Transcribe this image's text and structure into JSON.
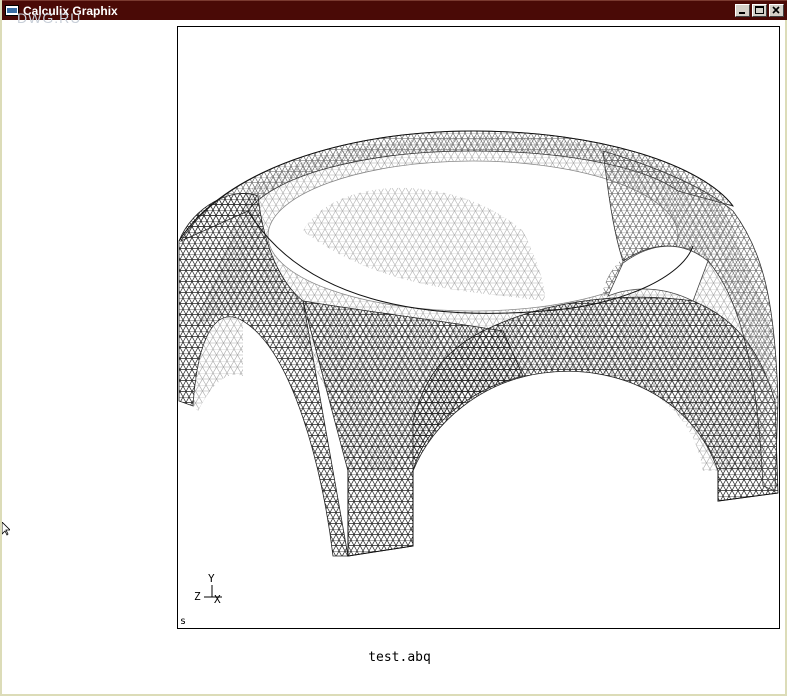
{
  "window": {
    "title": "Calculix Graphix",
    "controls": {
      "minimize": "minimize",
      "maximize": "maximize",
      "close": "close"
    }
  },
  "watermark": "DWG.RU",
  "viewport": {
    "axes": {
      "x": "X",
      "y": "Y",
      "z": "Z"
    },
    "status": "s",
    "colors": {
      "front_mesh": "#222222",
      "back_mesh": "#9a9a9a",
      "frame": "#000000"
    }
  },
  "file": {
    "name": "test.abq"
  }
}
